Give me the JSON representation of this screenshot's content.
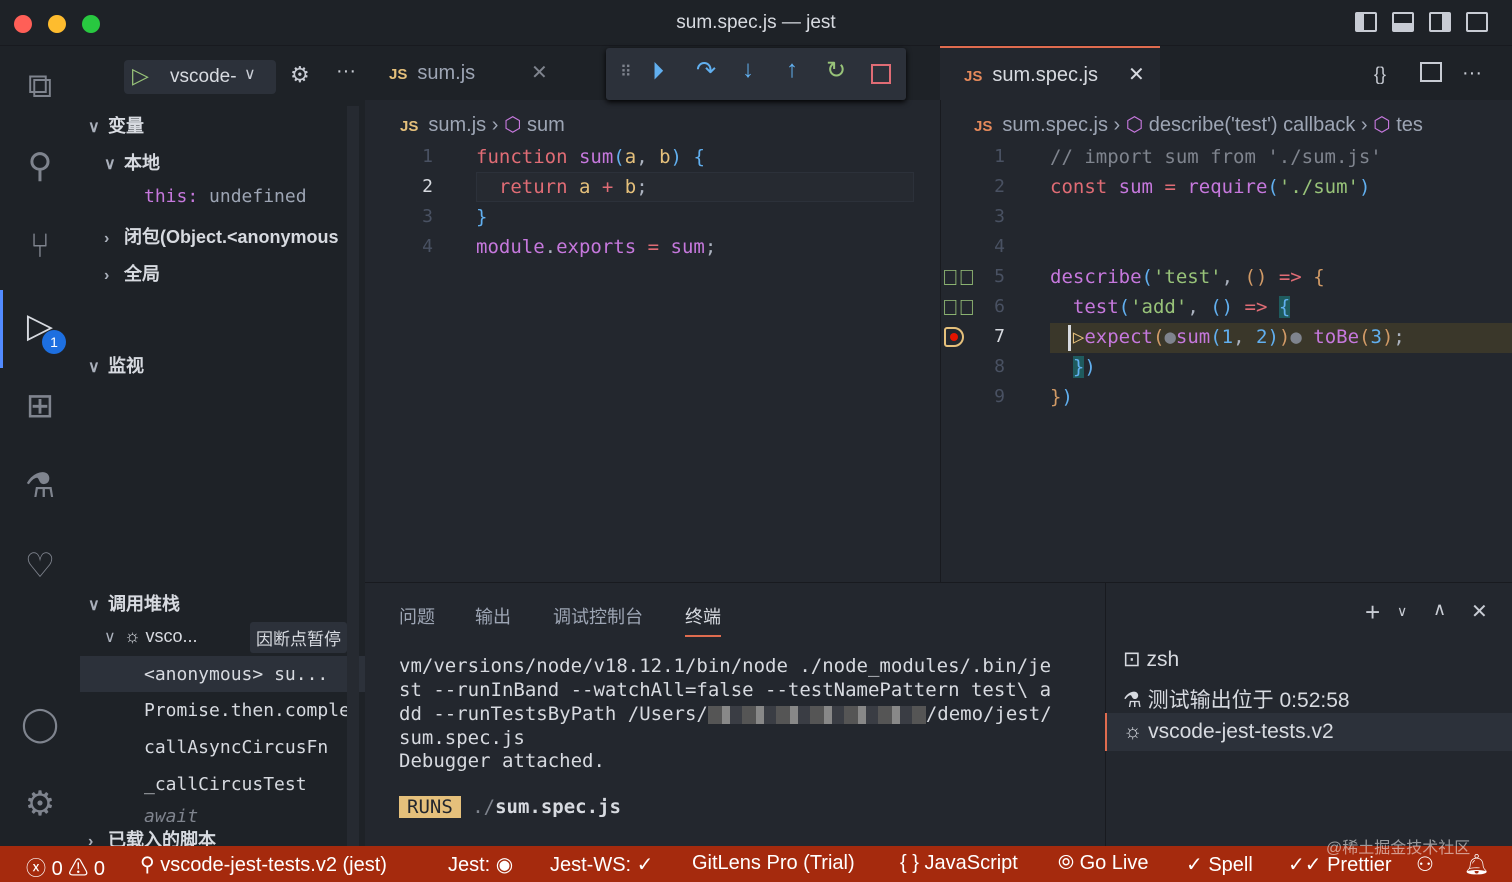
{
  "window": {
    "title": "sum.spec.js — jest"
  },
  "debug": {
    "config": "vscode-",
    "toolbar": [
      "continue",
      "step-over",
      "step-into",
      "step-out",
      "restart",
      "stop"
    ]
  },
  "sidebar": {
    "variables": "变量",
    "local": "本地",
    "this_key": "this:",
    "this_val": "undefined",
    "closure": "闭包(Object.<anonymous",
    "global": "全局",
    "watch": "监视",
    "callstack": "调用堆栈",
    "session": "vsco...",
    "paused": "因断点暂停",
    "frames": [
      {
        "name": "<anonymous>",
        "file": "su..."
      },
      {
        "name": "Promise.then.complet"
      },
      {
        "name": "callAsyncCircusFn"
      },
      {
        "name": "_callCircusTest"
      },
      {
        "name": "await"
      }
    ],
    "loaded": "已载入的脚本"
  },
  "left_editor": {
    "tab": "sum.js",
    "breadcrumb": [
      "sum.js",
      "sum"
    ],
    "lines": [
      1,
      2,
      3,
      4
    ]
  },
  "right_editor": {
    "tab": "sum.spec.js",
    "breadcrumb": [
      "sum.spec.js",
      "describe('test') callback",
      "tes"
    ],
    "lines": [
      1,
      2,
      3,
      4,
      5,
      6,
      7,
      8,
      9
    ]
  },
  "panel": {
    "tabs": [
      "问题",
      "输出",
      "调试控制台",
      "终端"
    ],
    "active_tab": "终端",
    "terminal": [
      "vm/versions/node/v18.12.1/bin/node ./node_modules/.bin/je",
      "st --runInBand --watchAll=false --testNamePattern test\\ a",
      "dd --runTestsByPath /Users/",
      "/demo/jest/",
      "sum.spec.js",
      "Debugger attached."
    ],
    "runs_badge": "RUNS",
    "runs_dir": "./",
    "runs_file": "sum.spec.js",
    "terminals": [
      "zsh",
      "测试输出位于 0:52:58",
      "vscode-jest-tests.v2"
    ]
  },
  "status": {
    "errors": "0",
    "warnings": "0",
    "debug": "vscode-jest-tests.v2 (jest)",
    "jest": "Jest:",
    "jest_ws": "Jest-WS: ✓",
    "gitlens": "GitLens Pro (Trial)",
    "lang": "JavaScript",
    "golive": "Go Live",
    "spell": "Spell",
    "prettier": "Prettier",
    "watermark": "@稀土掘金技术社区"
  },
  "colors": {
    "status_bg": "#a52a0d",
    "accent": "#528bff",
    "runs": "#e5c07b"
  }
}
